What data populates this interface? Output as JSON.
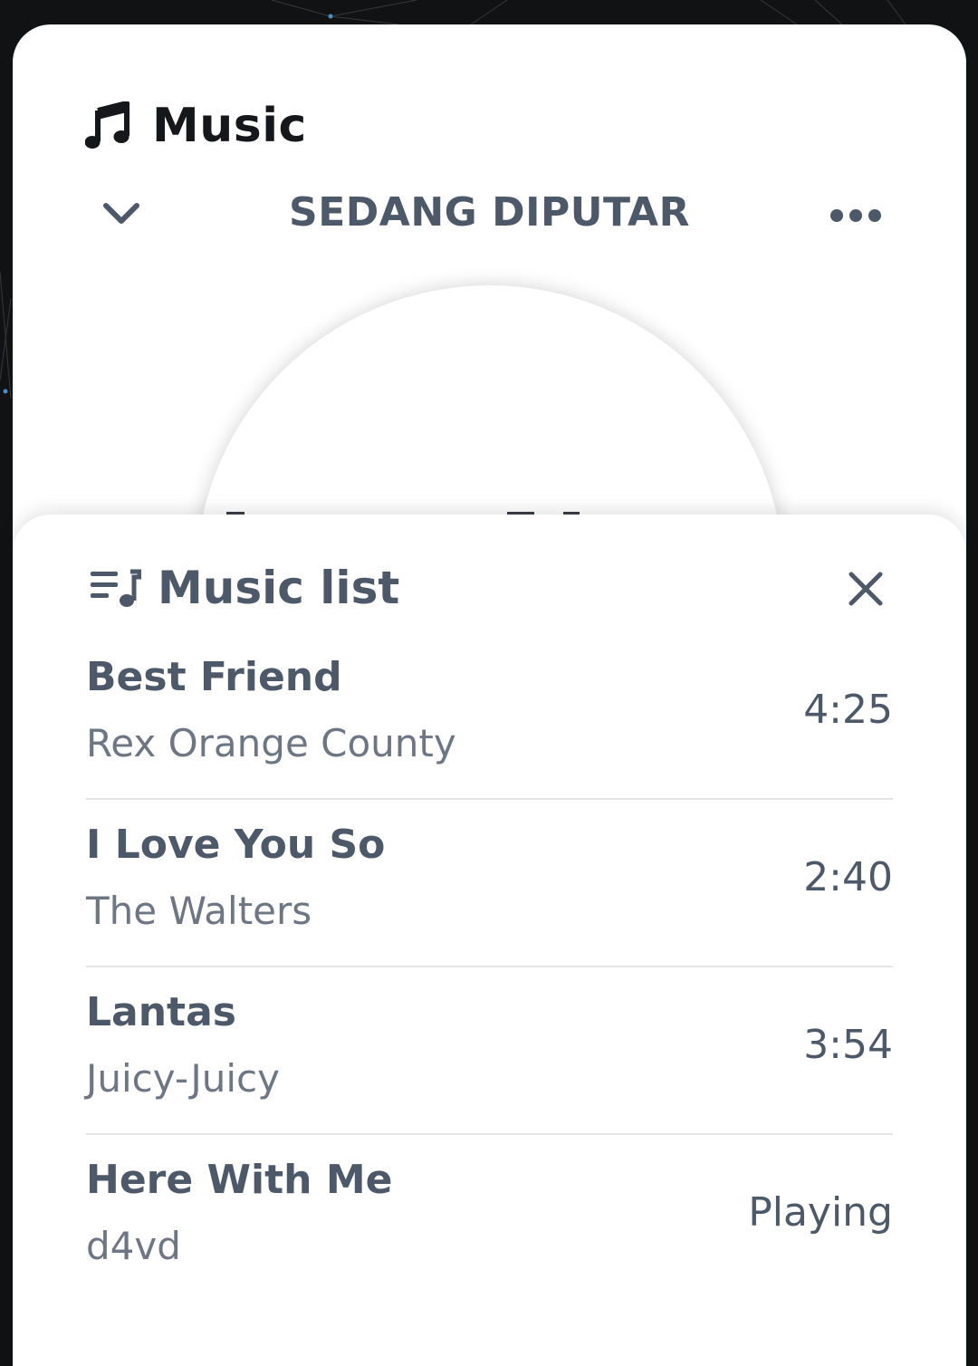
{
  "app": {
    "title": "Music",
    "icon": "music-note-icon"
  },
  "now_playing": {
    "label": "SEDANG DIPUTAR",
    "collapse_icon": "chevron-down-icon",
    "more_icon": "more-horizontal-icon"
  },
  "playlist": {
    "title": "Music list",
    "icon": "queue-music-icon",
    "close_icon": "close-icon",
    "tracks": [
      {
        "title": "Best Friend",
        "artist": "Rex Orange County",
        "duration": "4:25"
      },
      {
        "title": "I Love You So",
        "artist": "The Walters",
        "duration": "2:40"
      },
      {
        "title": "Lantas",
        "artist": "Juicy-Juicy",
        "duration": "3:54"
      },
      {
        "title": "Here With Me",
        "artist": "d4vd",
        "duration": "Playing"
      }
    ]
  },
  "colors": {
    "background": "#111214",
    "card": "#ffffff",
    "text_primary": "#4d5868",
    "text_secondary": "#6e7684",
    "divider": "#e3e5e8"
  }
}
